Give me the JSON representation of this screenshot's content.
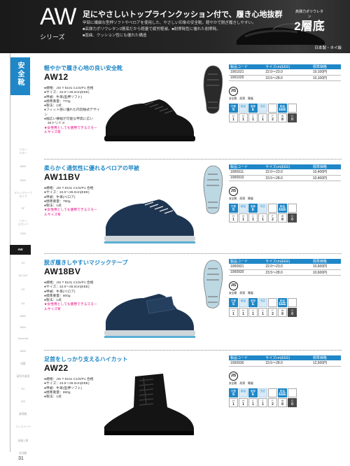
{
  "header": {
    "logo": "AW",
    "series_label": "シリーズ",
    "title": "足にやさしいトップラインクッション付で、履き心地抜群",
    "bullets": [
      "甲部に繊細な型押ソフトやベロアを使用した、やさしい印象の安全靴。軽やかで脱ぎ履きしやすい。",
      "■高弾力ポリウレタン2層底だから軽量で疲労軽減。■耐摩耗性に優れた耐摩耗。",
      "■屈曲、クッション性にも優れた構造"
    ],
    "badge_top": "高弾力ポリウレタン",
    "badge_main": "2層底",
    "made_in": "日本製・ネイ級"
  },
  "sidebar": {
    "category": "安全靴",
    "items": [
      {
        "label": "シモン\nスター",
        "active": false
      },
      {
        "label": "8800",
        "active": false
      },
      {
        "label": "8500",
        "active": false
      },
      {
        "label": "マジックテープ\nタイプ",
        "active": false
      },
      {
        "label": "SF",
        "active": false
      },
      {
        "label": "シモン\nスポーツ",
        "active": false
      },
      {
        "label": "7500",
        "active": false
      },
      {
        "label": "AW",
        "active": true
      },
      {
        "label": "SX",
        "active": false
      },
      {
        "label": "3D DAT",
        "active": false
      },
      {
        "label": "FD",
        "active": false
      },
      {
        "label": "M1",
        "active": false
      },
      {
        "label": "8800",
        "active": false
      },
      {
        "label": "8904",
        "active": false
      },
      {
        "label": "Mover48",
        "active": false
      },
      {
        "label": "8805",
        "active": false
      },
      {
        "label": "短靴",
        "active": false
      },
      {
        "label": "高所作業用",
        "active": false
      },
      {
        "label": "E2",
        "active": false
      },
      {
        "label": "WS",
        "active": false
      },
      {
        "label": "静電靴",
        "active": false
      },
      {
        "label": "フィラメント",
        "active": false
      },
      {
        "label": "長編上靴",
        "active": false
      },
      {
        "label": "耐滑靴",
        "active": false
      }
    ],
    "page_number": "31"
  },
  "table_headers": [
    "製品コード",
    "サイズcm(EEE)",
    "標準価格"
  ],
  "products": [
    {
      "catch": "軽やかで履き心地の良い安全靴",
      "code": "AW12",
      "specs": [
        "●規格：JIS T 8101 C1/S/P1 合格",
        "●サイズ：22.0〜28.0cm(EEE)",
        "●甲被：牛革(型押ソフト)",
        "●標準重量：770g",
        "●製法：1式",
        "●フィット感に優れた内羽根式デザイン",
        "●幅広い横幅が可能な甲高に広い",
        "　4Eトリドメ"
      ],
      "note": "★女性用としても使用できるスモールサイズ有",
      "shoe_color": "#151515",
      "shoe_type": "low",
      "sole_color": "#2a2a2a",
      "rows": [
        {
          "code": "1001021",
          "size": "22.0〜23.0",
          "price": "10,100円"
        },
        {
          "code": "1001020",
          "size": "23.5〜28.0",
          "price": "10,100円"
        }
      ],
      "attrs": [
        {
          "t": "作業",
          "v": "S",
          "c": "blue"
        },
        {
          "t": "耐油",
          "v": "",
          "c": "lt"
        },
        {
          "t": "衝撃",
          "v": "E",
          "c": "blue"
        },
        {
          "t": "先芯",
          "v": "",
          "c": "lt"
        },
        {
          "t": "",
          "v": "",
          "c": ""
        },
        {
          "t": "靴幅",
          "v": "EEE",
          "c": "blue"
        },
        {
          "t": "",
          "v": "",
          "c": ""
        },
        {
          "t": "H",
          "v": "1",
          "c": ""
        },
        {
          "t": "H",
          "v": "1",
          "c": ""
        },
        {
          "t": "C",
          "v": "1",
          "c": ""
        },
        {
          "t": "C",
          "v": "1",
          "c": ""
        },
        {
          "t": "F",
          "v": "2",
          "c": ""
        },
        {
          "t": "W",
          "v": "8",
          "c": ""
        },
        {
          "t": "D",
          "v": "0",
          "c": "dark"
        }
      ]
    },
    {
      "catch": "柔らかく通気性に優れるベロアの甲被",
      "code": "AW11BV",
      "specs": [
        "●規格：JIS T 8101 C1/S/P1 合格",
        "●サイズ：22.0〜28.0cm(EEE)",
        "●甲被：牛革(ベロア)",
        "●標準重量：780g",
        "●製法：1式"
      ],
      "note": "★女性用としても使用できるスモールサイズ有",
      "shoe_color": "#1e3552",
      "shoe_type": "lace",
      "sole_color": "#bcd8e2",
      "rows": [
        {
          "code": "1000911",
          "size": "22.0〜23.0",
          "price": "10,400円"
        },
        {
          "code": "1000910",
          "size": "23.5〜28.0",
          "price": "10,400円"
        }
      ],
      "attrs": [
        {
          "t": "作業",
          "v": "S",
          "c": "blue"
        },
        {
          "t": "耐油",
          "v": "",
          "c": "lt"
        },
        {
          "t": "衝撃",
          "v": "E",
          "c": "blue"
        },
        {
          "t": "先芯",
          "v": "",
          "c": "lt"
        },
        {
          "t": "",
          "v": "",
          "c": ""
        },
        {
          "t": "靴幅",
          "v": "EEE",
          "c": "blue"
        },
        {
          "t": "",
          "v": "",
          "c": ""
        },
        {
          "t": "H",
          "v": "1",
          "c": ""
        },
        {
          "t": "H",
          "v": "1",
          "c": ""
        },
        {
          "t": "C",
          "v": "1",
          "c": ""
        },
        {
          "t": "C",
          "v": "1",
          "c": ""
        },
        {
          "t": "F",
          "v": "2",
          "c": ""
        },
        {
          "t": "W",
          "v": "8",
          "c": ""
        },
        {
          "t": "D",
          "v": "0",
          "c": "dark"
        }
      ]
    },
    {
      "catch": "脱ぎ履きしやすいマジックテープ",
      "code": "AW18BV",
      "specs": [
        "●規格：JIS T 8101 C1/S/P1 合格",
        "●サイズ：22.0〜28.0cm(EEE)",
        "●甲被：牛革(ベロア)",
        "●標準重量：800g",
        "●製法：1式"
      ],
      "note": "★女性用としても使用できるスモールサイズ有",
      "shoe_color": "#1e3552",
      "shoe_type": "strap",
      "sole_color": "#bcd8e2",
      "rows": [
        {
          "code": "1000921",
          "size": "22.0〜23.0",
          "price": "10,600円"
        },
        {
          "code": "1000920",
          "size": "23.5〜28.0",
          "price": "10,600円"
        }
      ],
      "attrs": [
        {
          "t": "作業",
          "v": "S",
          "c": "blue"
        },
        {
          "t": "耐油",
          "v": "",
          "c": "lt"
        },
        {
          "t": "衝撃",
          "v": "E",
          "c": "blue"
        },
        {
          "t": "先芯",
          "v": "",
          "c": "lt"
        },
        {
          "t": "",
          "v": "",
          "c": ""
        },
        {
          "t": "靴幅",
          "v": "EEE",
          "c": "blue"
        },
        {
          "t": "",
          "v": "",
          "c": ""
        },
        {
          "t": "H",
          "v": "1",
          "c": ""
        },
        {
          "t": "H",
          "v": "1",
          "c": ""
        },
        {
          "t": "C",
          "v": "1",
          "c": ""
        },
        {
          "t": "C",
          "v": "1",
          "c": ""
        },
        {
          "t": "F",
          "v": "2",
          "c": ""
        },
        {
          "t": "W",
          "v": "8",
          "c": ""
        },
        {
          "t": "D",
          "v": "0",
          "c": "dark"
        }
      ]
    },
    {
      "catch": "足首をしっかり支えるハイカット",
      "code": "AW22",
      "specs": [
        "●規格：JIS T 8101 C1/S/P1 合格",
        "●サイズ：23.5〜28.0cm(EEE)",
        "●甲被：牛革(型押ソフト)",
        "●標準重量：860g",
        "●製法：1式"
      ],
      "note": "",
      "shoe_color": "#141414",
      "shoe_type": "high",
      "sole_color": "",
      "rows": [
        {
          "code": "1000930",
          "size": "23.5〜28.0",
          "price": "12,500円"
        }
      ],
      "attrs": [
        {
          "t": "作業",
          "v": "S",
          "c": "blue"
        },
        {
          "t": "耐油",
          "v": "",
          "c": "lt"
        },
        {
          "t": "衝撃",
          "v": "E",
          "c": "blue"
        },
        {
          "t": "先芯",
          "v": "",
          "c": "lt"
        },
        {
          "t": "",
          "v": "",
          "c": ""
        },
        {
          "t": "靴幅",
          "v": "EEE",
          "c": "blue"
        },
        {
          "t": "",
          "v": "",
          "c": ""
        },
        {
          "t": "H",
          "v": "1",
          "c": ""
        },
        {
          "t": "H",
          "v": "1",
          "c": ""
        },
        {
          "t": "C",
          "v": "1",
          "c": ""
        },
        {
          "t": "C",
          "v": "1",
          "c": ""
        },
        {
          "t": "F",
          "v": "2",
          "c": ""
        },
        {
          "t": "W",
          "v": "8",
          "c": ""
        },
        {
          "t": "D",
          "v": "0",
          "c": "dark"
        }
      ]
    }
  ],
  "cert": {
    "jis": "JIS",
    "labels": [
      "安全靴",
      "耐滑",
      "靴幅"
    ]
  },
  "colors": {
    "accent": "#1f87c7",
    "note": "#e5007f",
    "header_bg": "#1d1d1d"
  }
}
